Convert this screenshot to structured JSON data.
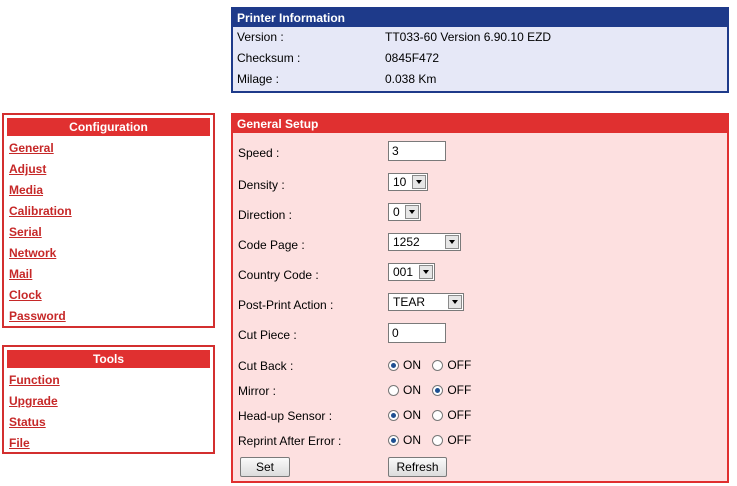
{
  "printer_info": {
    "title": "Printer Information",
    "rows": [
      {
        "label": "Version :",
        "value": "TT033-60 Version 6.90.10 EZD"
      },
      {
        "label": "Checksum :",
        "value": "0845F472"
      },
      {
        "label": "Milage :",
        "value": "0.038 Km"
      }
    ]
  },
  "configuration": {
    "title": "Configuration",
    "links": [
      "General",
      "Adjust",
      "Media",
      "Calibration",
      "Serial",
      "Network",
      "Mail",
      "Clock",
      "Password"
    ]
  },
  "tools": {
    "title": "Tools",
    "links": [
      "Function",
      "Upgrade",
      "Status",
      "File"
    ]
  },
  "general_setup": {
    "title": "General Setup",
    "speed": {
      "label": "Speed :",
      "value": "3"
    },
    "density": {
      "label": "Density :",
      "value": "10"
    },
    "direction": {
      "label": "Direction :",
      "value": "0"
    },
    "code_page": {
      "label": "Code Page :",
      "value": "1252"
    },
    "country_code": {
      "label": "Country Code :",
      "value": "001"
    },
    "post_print": {
      "label": "Post-Print Action :",
      "value": "TEAR"
    },
    "cut_piece": {
      "label": "Cut Piece :",
      "value": "0"
    },
    "on_label": "ON",
    "off_label": "OFF",
    "cut_back": {
      "label": "Cut Back :",
      "selected": "ON"
    },
    "mirror": {
      "label": "Mirror :",
      "selected": "OFF"
    },
    "head_up": {
      "label": "Head-up Sensor :",
      "selected": "ON"
    },
    "reprint": {
      "label": "Reprint After Error :",
      "selected": "ON"
    },
    "set_label": "Set",
    "refresh_label": "Refresh"
  },
  "colors": {
    "blue_header": "#1e3a8a",
    "red_header": "#e03030",
    "link": "#c62828"
  }
}
